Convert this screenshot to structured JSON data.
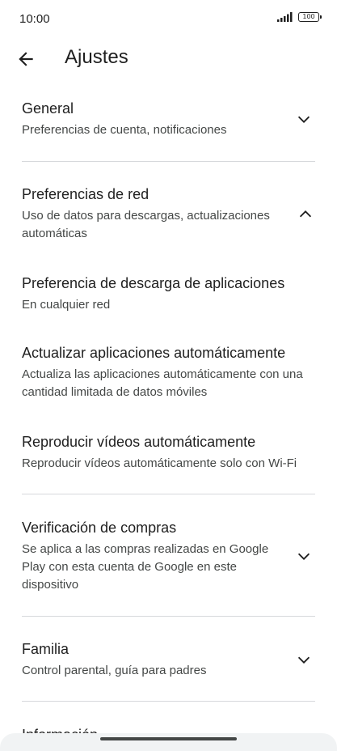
{
  "status": {
    "time": "10:00",
    "battery": "100"
  },
  "header": {
    "title": "Ajustes"
  },
  "sections": {
    "general": {
      "title": "General",
      "subtitle": "Preferencias de cuenta, notificaciones"
    },
    "network": {
      "title": "Preferencias de red",
      "subtitle": "Uso de datos para descargas, actualizaciones automáticas"
    },
    "app_download": {
      "title": "Preferencia de descarga de aplicaciones",
      "subtitle": "En cualquier red"
    },
    "auto_update": {
      "title": "Actualizar aplicaciones automáticamente",
      "subtitle": "Actualiza las aplicaciones automáticamente con una cantidad limitada de datos móviles"
    },
    "autoplay": {
      "title": "Reproducir vídeos automáticamente",
      "subtitle": "Reproducir vídeos automáticamente solo con Wi-Fi"
    },
    "purchase": {
      "title": "Verificación de compras",
      "subtitle": "Se aplica a las compras realizadas en Google Play con esta cuenta de Google en este dispositivo"
    },
    "family": {
      "title": "Familia",
      "subtitle": "Control parental, guía para padres"
    },
    "info": {
      "title": "Información"
    }
  },
  "icons": {
    "back": "arrow-back-icon",
    "expand": "chevron-down-icon",
    "collapse": "chevron-up-icon",
    "signal": "signal-icon",
    "battery": "battery-icon"
  }
}
